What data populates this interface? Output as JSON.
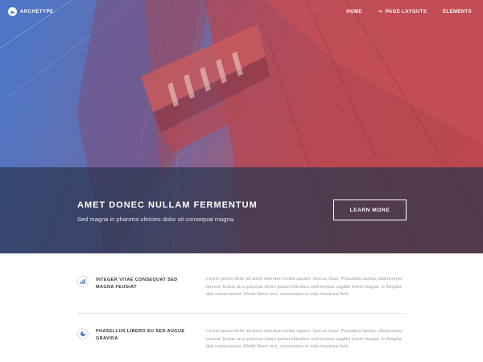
{
  "brand": {
    "name": "ARCHETYPE"
  },
  "nav": {
    "items": [
      {
        "label": "HOME"
      },
      {
        "label": "PAGE LAYOUTS",
        "icon": "chevron-down-icon"
      },
      {
        "label": "ELEMENTS"
      }
    ]
  },
  "hero": {
    "title": "AMET DONEC NULLAM FERMENTUM",
    "subtitle": "Sed magna in pharetra ultricies dolor sit consequat magna.",
    "button_label": "LEARN MORE"
  },
  "features": [
    {
      "icon": "chart-icon",
      "title": "INTEGER VITAE CONSEQUAT SED MAGNA FEUGIAT",
      "text": "Lorem ipsum dolor sit amet interdum mollis sapien. Sed ac risus. Phasellus lacinia, ullamcorper laoreet, lectus arcu pulvinar lorem ipsum interdum sed tempus sagittis lorem feugiat. In fringilla diet consectetuer. Morbi libero orci, consectetur in odio maximus felis."
    },
    {
      "icon": "pie-chart-icon",
      "title": "PHASELLUS LIBERO EU SED AUGUE GRAVIDA",
      "text": "Lorem ipsum dolor sit amet interdum mollis sapien. Sed ac risus. Phasellus lacinia, ullamcorper laoreet, lectus arcu pulvinar lorem ipsum interdum sed tempus sagittis lorem feugiat. In fringilla diet consectetuer. Morbi libero orci, consectetur in odio maximus felis."
    }
  ],
  "colors": {
    "hero_gradient_left": "#4a78c9",
    "hero_gradient_right": "#c94a4e",
    "banner_overlay": "#28344e",
    "icon_accent": "#4a78c9"
  }
}
